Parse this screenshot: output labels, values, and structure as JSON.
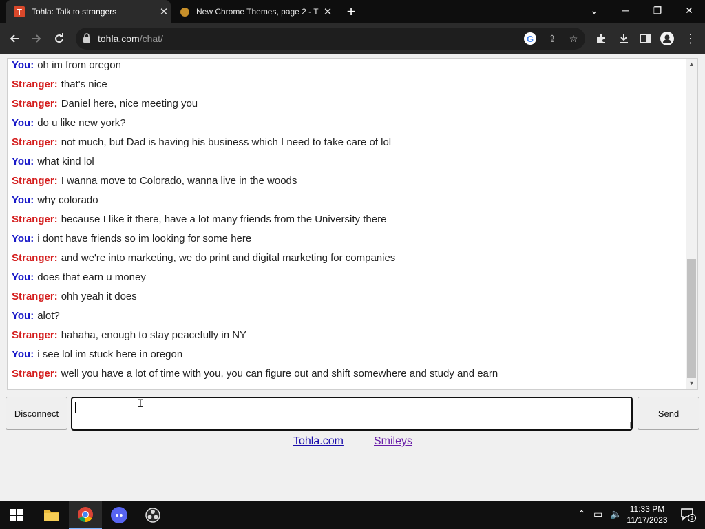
{
  "browser": {
    "tabs": [
      {
        "title": "Tohla: Talk to strangers",
        "active": true
      },
      {
        "title": "New Chrome Themes, page 2 - T",
        "active": false
      }
    ],
    "url_domain": "tohla.com",
    "url_path": "/chat/",
    "colors": {
      "frame": "#0e0e0e",
      "toolbar": "#2b2b2b"
    }
  },
  "chat": {
    "you_label": "You:",
    "stranger_label": "Stranger:",
    "messages": [
      {
        "who": "You:",
        "text": "oh im from oregon"
      },
      {
        "who": "Stranger:",
        "text": "that's nice"
      },
      {
        "who": "Stranger:",
        "text": "Daniel here, nice meeting you"
      },
      {
        "who": "You:",
        "text": "do u like new york?"
      },
      {
        "who": "Stranger:",
        "text": "not much, but Dad is having his business which I need to take care of lol"
      },
      {
        "who": "You:",
        "text": "what kind lol"
      },
      {
        "who": "Stranger:",
        "text": "I wanna move to Colorado, wanna live in the woods"
      },
      {
        "who": "You:",
        "text": "why colorado"
      },
      {
        "who": "Stranger:",
        "text": "because I like it there, have a lot many friends from the University there"
      },
      {
        "who": "You:",
        "text": "i dont have friends so im looking for some here"
      },
      {
        "who": "Stranger:",
        "text": "and we're into marketing, we do print and digital marketing for companies"
      },
      {
        "who": "You:",
        "text": "does that earn u money"
      },
      {
        "who": "Stranger:",
        "text": "ohh yeah it does"
      },
      {
        "who": "You:",
        "text": "alot?"
      },
      {
        "who": "Stranger:",
        "text": "hahaha, enough to stay peacefully in NY"
      },
      {
        "who": "You:",
        "text": "i see lol im stuck here in oregon"
      },
      {
        "who": "Stranger:",
        "text": "well you have a lot of time with you, you can figure out and shift somewhere and study and earn"
      }
    ],
    "colors": {
      "you": "#1919c8",
      "stranger": "#d41e1e"
    }
  },
  "controls": {
    "disconnect_label": "Disconnect",
    "send_label": "Send",
    "message_value": ""
  },
  "footer_links": [
    {
      "label": "Tohla.com"
    },
    {
      "label": "Smileys"
    }
  ],
  "taskbar": {
    "time": "11:33 PM",
    "date": "11/17/2023",
    "notification_count": "2",
    "apps": [
      "windows-start",
      "file-explorer",
      "chrome",
      "discord",
      "obs"
    ]
  }
}
